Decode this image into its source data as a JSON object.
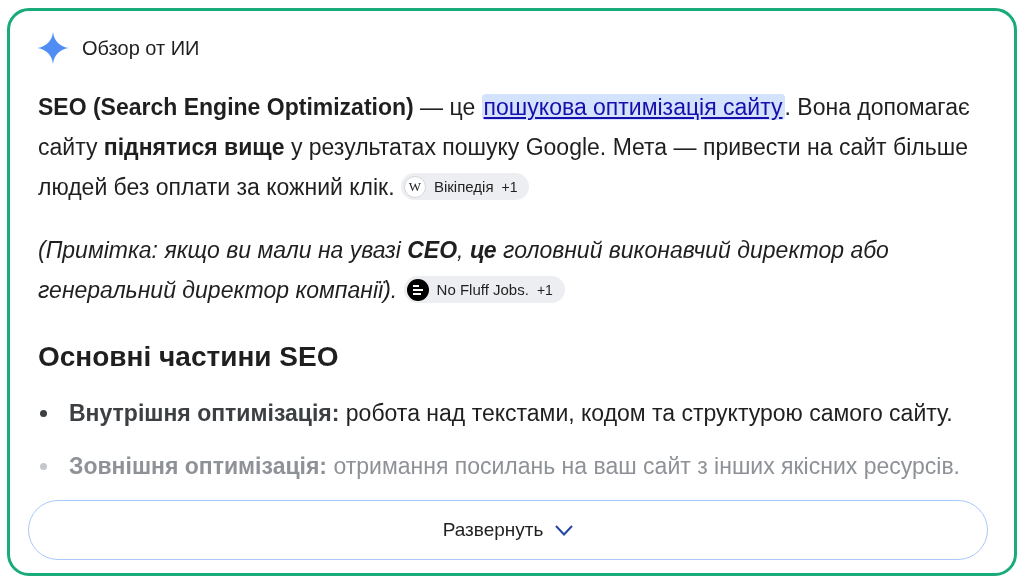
{
  "header": {
    "title": "Обзор от ИИ"
  },
  "intro": {
    "before_link": "**SEO (Search Engine Optimization)** — це ",
    "link": "пошукова оптимізація сайту",
    "after_link": ". Вона допомагає сайту **піднятися вище** у результатах пошуку Google. Мета — привести на сайт більше людей без оплати за кожний клік.",
    "source": {
      "kind": "wiki",
      "logo_text": "W",
      "label": "Вікіпедія",
      "count": "+1"
    }
  },
  "note": {
    "text": "(Примітка: якщо ви мали на увазі **CEO**, **це** головний виконавчий директор або генеральний директор компанії).",
    "source": {
      "kind": "badge",
      "label": "No Fluff Jobs.",
      "count": "+1"
    }
  },
  "section": {
    "heading": "Основні частини SEO",
    "items": [
      {
        "title": "Внутрішня оптимізація:",
        "text": "робота над текстами, кодом та структурою самого сайту.",
        "faded": false
      },
      {
        "title": "Зовнішня оптимізація:",
        "text": "отримання посилань на ваш сайт з інших якісних ресурсів.",
        "faded": true
      }
    ]
  },
  "expand_button": {
    "label": "Развернуть"
  }
}
